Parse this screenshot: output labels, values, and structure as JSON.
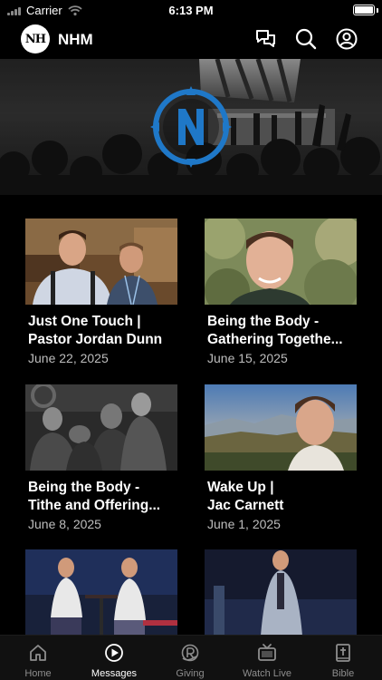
{
  "status_bar": {
    "carrier": "Carrier",
    "time": "6:13 PM"
  },
  "header": {
    "logo_text": "NH",
    "title": "NHM"
  },
  "icons": {
    "chat": "chat-bubbles-icon",
    "search": "search-icon",
    "account": "account-icon"
  },
  "messages": [
    {
      "title_line1": "Just One Touch |",
      "title_line2": "Pastor Jordan Dunn",
      "date": "June 22, 2025"
    },
    {
      "title_line1": "Being the Body -",
      "title_line2": "Gathering Togethe...",
      "date": "June 15, 2025"
    },
    {
      "title_line1": "Being the Body -",
      "title_line2": "Tithe and Offering...",
      "date": "June 8, 2025"
    },
    {
      "title_line1": "Wake Up |",
      "title_line2": "Jac Carnett",
      "date": "June 1, 2025"
    }
  ],
  "tabs": [
    {
      "label": "Home",
      "icon": "home-icon"
    },
    {
      "label": "Messages",
      "icon": "play-circle-icon",
      "active": true
    },
    {
      "label": "Giving",
      "icon": "giving-icon"
    },
    {
      "label": "Watch Live",
      "icon": "tv-icon"
    },
    {
      "label": "Bible",
      "icon": "bible-icon"
    }
  ],
  "colors": {
    "background": "#000000",
    "brand_blue": "#1f78c8",
    "tab_inactive": "#8e8e8e"
  }
}
